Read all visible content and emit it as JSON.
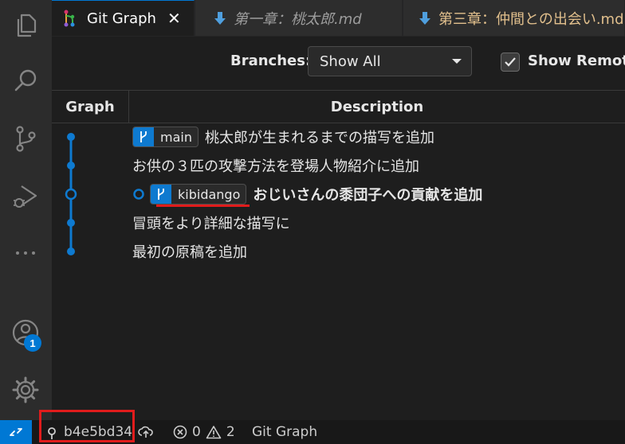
{
  "tabs": [
    {
      "label": "Git Graph",
      "active": true,
      "icon": "git-graph-icon"
    },
    {
      "label": "第一章：桃太郎.md",
      "active": false,
      "icon": "markdown-arrow-icon"
    },
    {
      "label": "第三章：仲間との出会い.md",
      "active": false,
      "icon": "markdown-arrow-icon"
    }
  ],
  "controls": {
    "branches_label": "Branches:",
    "branches_value": "Show All",
    "show_remote_label": "Show Remote",
    "show_remote_checked": true
  },
  "table": {
    "col_graph": "Graph",
    "col_description": "Description"
  },
  "commits": [
    {
      "ref": "main",
      "message": "桃太郎が生まれるまでの描写を追加",
      "bold": false,
      "head": false
    },
    {
      "ref": "",
      "message": "お供の３匹の攻撃方法を登場人物紹介に追加",
      "bold": false,
      "head": false
    },
    {
      "ref": "kibidango",
      "message": "おじいさんの黍団子への貢献を追加",
      "bold": true,
      "head": true
    },
    {
      "ref": "",
      "message": "冒頭をより詳細な描写に",
      "bold": false,
      "head": false
    },
    {
      "ref": "",
      "message": "最初の原稿を追加",
      "bold": false,
      "head": false
    }
  ],
  "activity_bar": {
    "items": [
      "explorer-icon",
      "search-icon",
      "source-control-icon",
      "run-debug-icon",
      "more-icon"
    ],
    "accounts_badge": "1"
  },
  "statusbar": {
    "commit": "b4e5bd34",
    "errors": "0",
    "warnings": "2",
    "git_graph": "Git Graph"
  },
  "colors": {
    "accent": "#0078d4",
    "graph_line": "#0e7ad0",
    "highlight_red": "#e11c1c",
    "tab3_text": "#e2c08d"
  }
}
